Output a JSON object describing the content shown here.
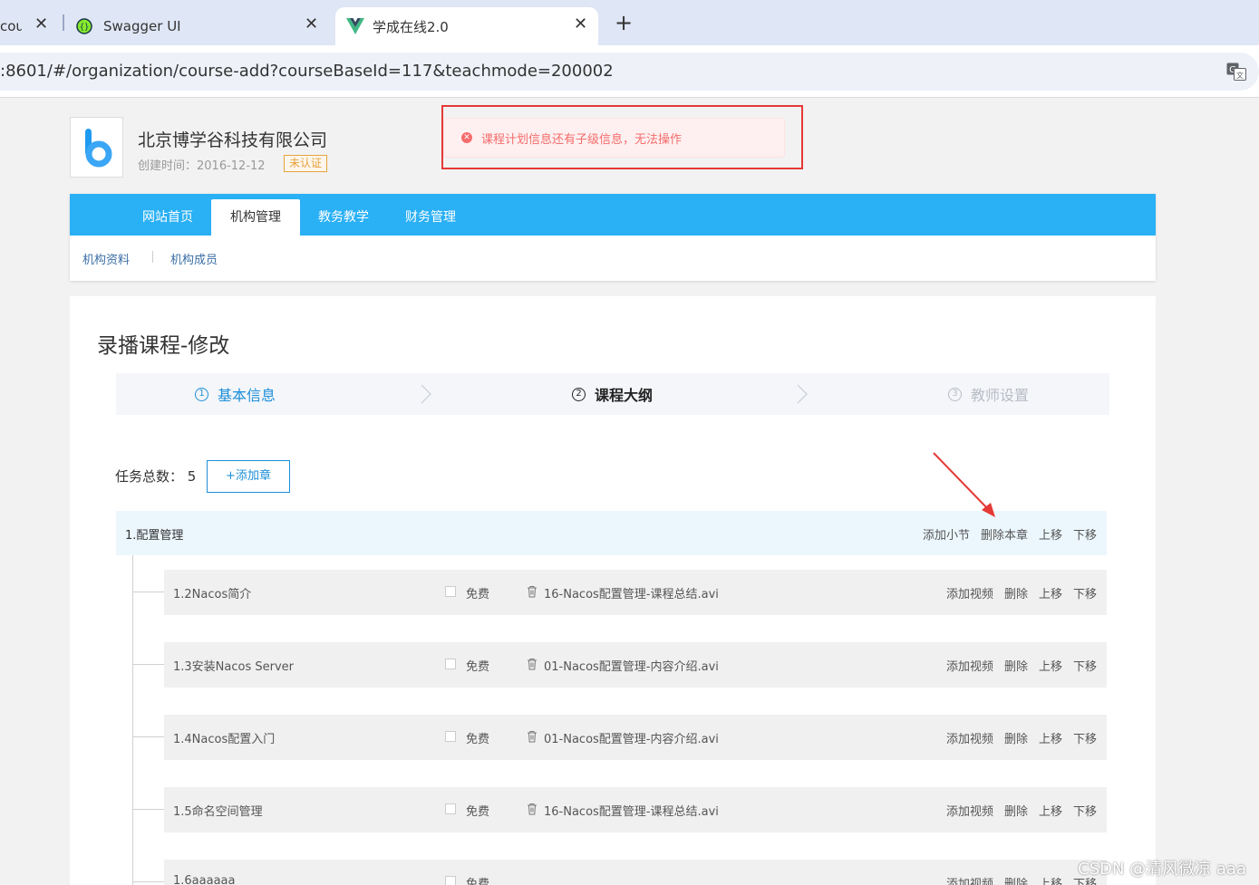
{
  "browser": {
    "tabs": [
      {
        "label": "cou",
        "close": "✕"
      },
      {
        "label": "Swagger UI",
        "close": "✕"
      },
      {
        "label": "学成在线2.0",
        "close": "✕"
      }
    ],
    "new_tab": "+",
    "url": ":8601/#/organization/course-add?courseBaseId=117&teachmode=200002"
  },
  "org": {
    "name": "北京博学谷科技有限公司",
    "created": "创建时间：2016-12-12",
    "badge": "未认证",
    "logo_letter": "b",
    "logo_color": "#1e9bf0"
  },
  "alert": {
    "icon": "✕",
    "text": "课程计划信息还有子级信息，无法操作",
    "color": "#f56c6c"
  },
  "nav": {
    "items": [
      "网站首页",
      "机构管理",
      "教务教学",
      "财务管理"
    ],
    "active": "机构管理",
    "sub_items": [
      "机构资料",
      "机构成员"
    ],
    "bar_color": "#2ab0f5"
  },
  "main": {
    "title": "录播课程-修改",
    "steps": [
      {
        "num": "1",
        "label": "基本信息"
      },
      {
        "num": "2",
        "label": "课程大纲"
      },
      {
        "num": "3",
        "label": "教师设置"
      }
    ],
    "total_label": "任务总数：",
    "total_count": "5",
    "add_chapter": "+添加章",
    "chapter": {
      "title": "1.配置管理",
      "actions": [
        "添加小节",
        "删除本章",
        "上移",
        "下移"
      ]
    },
    "sections": [
      {
        "title": "1.2Nacos简介",
        "free": "免费",
        "file": "16-Nacos配置管理-课程总结.avi"
      },
      {
        "title": "1.3安装Nacos Server",
        "free": "免费",
        "file": "01-Nacos配置管理-内容介绍.avi"
      },
      {
        "title": "1.4Nacos配置入门",
        "free": "免费",
        "file": "01-Nacos配置管理-内容介绍.avi"
      },
      {
        "title": "1.5命名空间管理",
        "free": "免费",
        "file": "16-Nacos配置管理-课程总结.avi"
      },
      {
        "title": "1.6aaaaaa",
        "free": "免费",
        "file": ""
      }
    ],
    "section_actions": [
      "添加视频",
      "删除",
      "上移",
      "下移"
    ]
  },
  "watermark": "CSDN @清风微凉 aaa"
}
